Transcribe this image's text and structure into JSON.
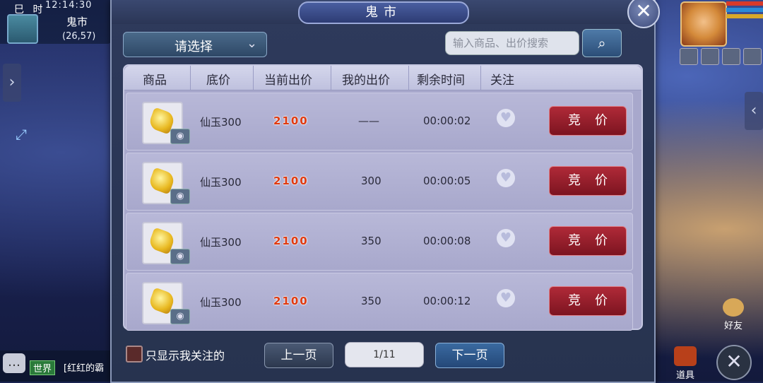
{
  "hud": {
    "period": "巳 时",
    "clock": "12:14:30",
    "map_name": "鬼市",
    "coords": "(26,57)"
  },
  "dialog": {
    "title": "鬼市"
  },
  "filter": {
    "select_label": "请选择",
    "search_placeholder": "输入商品、出价搜索"
  },
  "table": {
    "headers": [
      "商品",
      "底价",
      "当前出价",
      "我的出价",
      "剩余时间",
      "关注"
    ],
    "rows": [
      {
        "item": "仙玉300",
        "current_bid": "2100",
        "my_bid": "——",
        "time_left": "00:00:02",
        "action": "竞价"
      },
      {
        "item": "仙玉300",
        "current_bid": "2100",
        "my_bid": "300",
        "time_left": "00:00:05",
        "action": "竞价"
      },
      {
        "item": "仙玉300",
        "current_bid": "2100",
        "my_bid": "350",
        "time_left": "00:00:08",
        "action": "竞价"
      },
      {
        "item": "仙玉300",
        "current_bid": "2100",
        "my_bid": "350",
        "time_left": "00:00:12",
        "action": "竞价"
      }
    ]
  },
  "footer": {
    "only_followed_label": "只显示我关注的",
    "prev_label": "上一页",
    "page_info": "1/11",
    "next_label": "下一页"
  },
  "side": {
    "friends_label": "好友",
    "items_label": "道具"
  },
  "chat": {
    "channel": "世界",
    "message": "[红红的霸"
  },
  "colors": {
    "price": "#e03a10",
    "bid_button": "#9a1e2c",
    "panel": "#a8a8cc"
  }
}
